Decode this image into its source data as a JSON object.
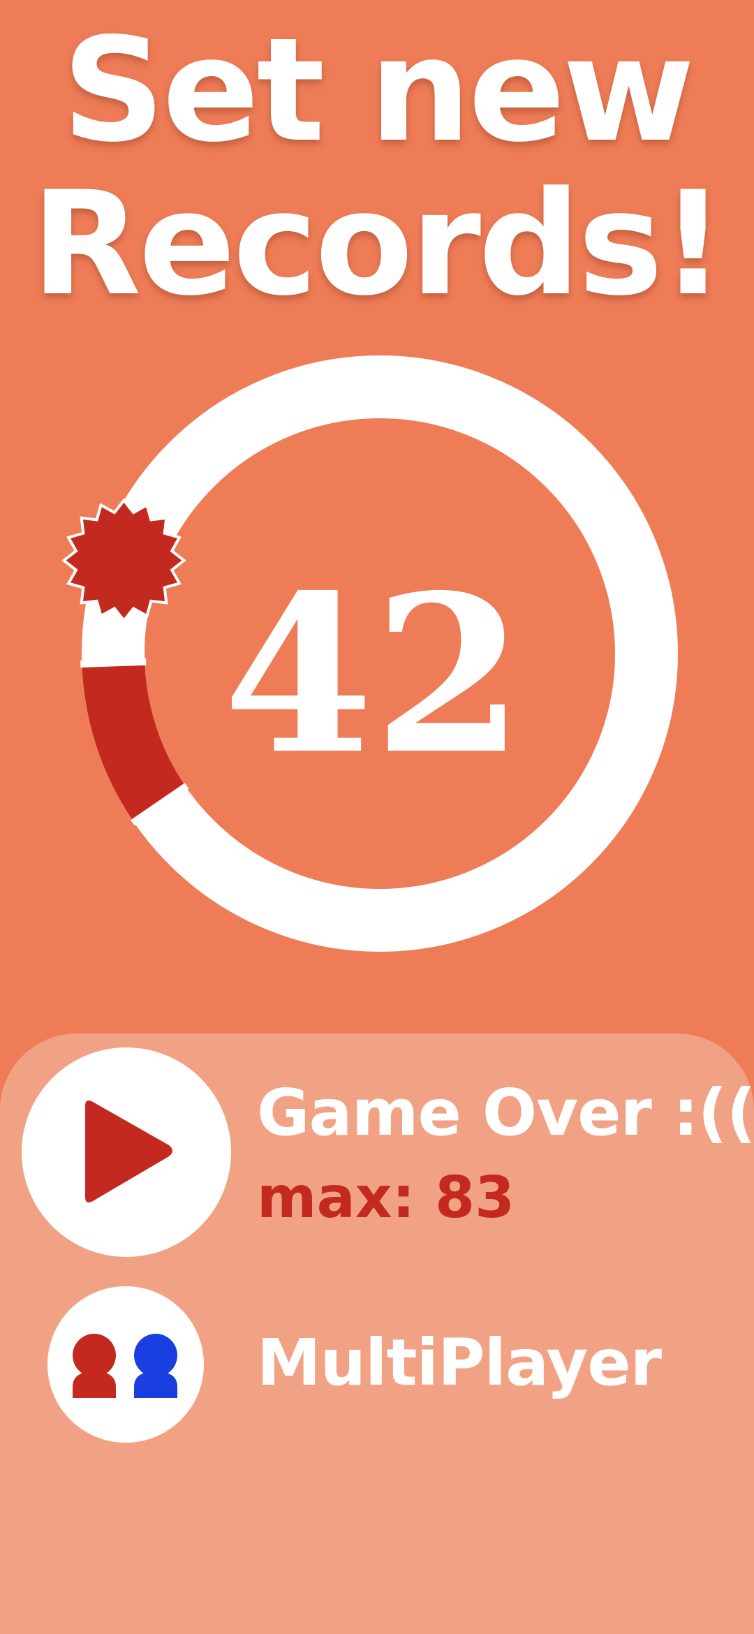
{
  "headline": {
    "line1": "Set new",
    "line2": "Records!"
  },
  "game": {
    "score": "42",
    "progress_fraction": 0.09
  },
  "menu": {
    "game_over_label": "Game Over :((",
    "max_label": "max: 83",
    "multiplayer_label": "MultiPlayer",
    "play_icon": "play-icon",
    "players_icon": "two-players-icon"
  },
  "colors": {
    "background": "#ee7d57",
    "panel": "#f2a284",
    "accent_red": "#c3291f",
    "accent_blue": "#1a3fe0",
    "white": "#ffffff"
  }
}
